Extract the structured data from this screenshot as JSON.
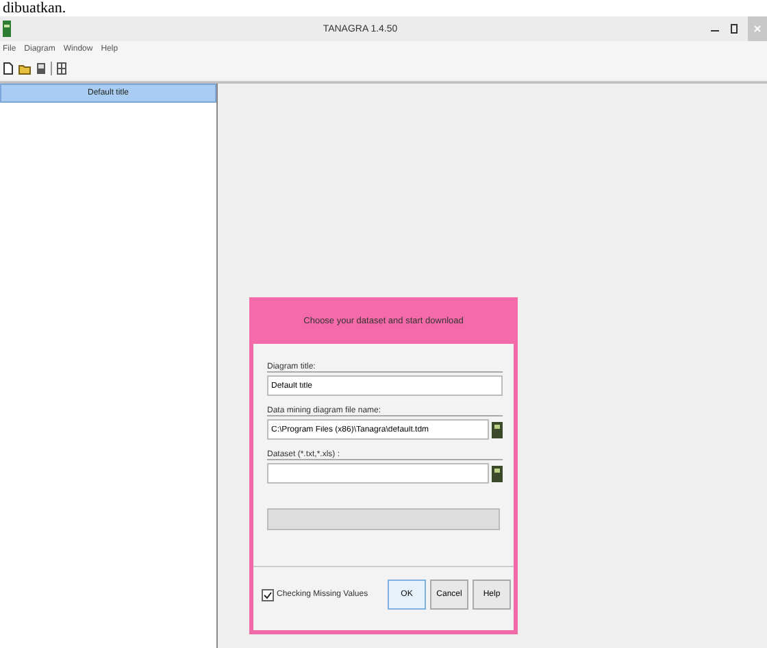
{
  "caption": "dibuatkan.",
  "window": {
    "title": "TANAGRA 1.4.50"
  },
  "menu": [
    "File",
    "Diagram",
    "Window",
    "Help"
  ],
  "sidebar": {
    "header": "Default title"
  },
  "dialog": {
    "title": "Choose your dataset and start download",
    "fields": [
      {
        "label": "Diagram title:",
        "value": "Default title",
        "kind": "text"
      },
      {
        "label": "Data mining diagram file name:",
        "value": "C:\\Program Files (x86)\\Tanagra\\default.tdm",
        "kind": "file"
      },
      {
        "label": "Dataset (*.txt,*.xls) :",
        "kind": "file"
      }
    ],
    "progress": {
      "level": 0
    },
    "checkbox": {
      "label": "Checking Missing Values",
      "checked": true
    },
    "buttons": [
      {
        "label": "OK",
        "selected": true
      },
      {
        "label": "Cancel",
        "selected": false
      },
      {
        "label": "Help",
        "selected": false
      }
    ]
  }
}
